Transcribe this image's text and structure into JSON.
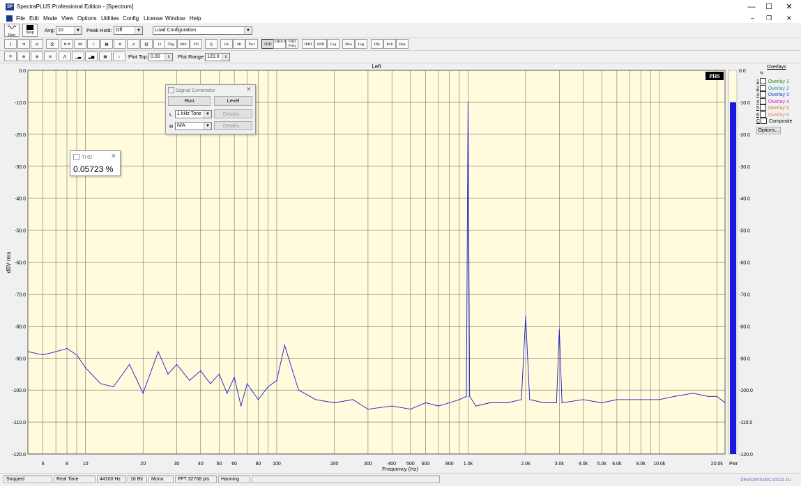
{
  "window": {
    "title": "SpectraPLUS Professional Edition - [Spectrum]",
    "app_icon": "SP",
    "min_glyph": "—",
    "max_glyph": "☐",
    "close_glyph": "✕"
  },
  "menu": [
    "File",
    "Edit",
    "Mode",
    "View",
    "Options",
    "Utilities",
    "Config",
    "License",
    "Window",
    "Help"
  ],
  "toolbar1": {
    "run_label": "Run",
    "stop_label": "Stop",
    "avg_label": "Avg:",
    "avg_value": "10",
    "peak_hold_label": "Peak Hold:",
    "peak_hold_value": "Off",
    "load_config_value": "Load Configuration"
  },
  "toolbar2": {
    "buttons": [
      "Trig",
      "Mrk",
      "I/O",
      "Hz",
      "dB",
      "Pwr",
      "THD",
      "THD+N",
      "THD Freq",
      "IMD",
      "SNR",
      "Leq",
      "Mus",
      "Log",
      "Dly",
      "Rvb",
      "Rep"
    ]
  },
  "toolbar3": {
    "plot_top_label": "Plot Top:",
    "plot_top_value": "0.00",
    "plot_range_label": "Plot Range:",
    "plot_range_value": "120.0"
  },
  "plot": {
    "title": "Left",
    "logo": "PHS",
    "pwr_label": "Pwr"
  },
  "signal_generator": {
    "title": "Signal Generator",
    "run_label": "Run",
    "level_label": "Level",
    "l_label": "L",
    "l_value": "1 kHz Tone",
    "l_details": "Details...",
    "r_label": "R",
    "r_value": "N/A",
    "r_details": "Details..."
  },
  "thd_window": {
    "title": "THD",
    "value": "0.05723 %"
  },
  "overlays": {
    "title": "Overlays",
    "header_glyph": "%",
    "items": [
      {
        "num": "1",
        "label": "Overlay 1",
        "color": "#2e8b2e"
      },
      {
        "num": "2",
        "label": "Overlay 2",
        "color": "#20a0a0"
      },
      {
        "num": "3",
        "label": "Overlay 3",
        "color": "#1a3bd0"
      },
      {
        "num": "4",
        "label": "Overlay 4",
        "color": "#d020d0"
      },
      {
        "num": "5",
        "label": "Overlay 5",
        "color": "#c08020"
      },
      {
        "num": "6",
        "label": "Overlay 6",
        "color": "#e08080"
      },
      {
        "num": "C",
        "label": "Composite",
        "color": "#000000"
      }
    ],
    "options_label": "Options..."
  },
  "status": {
    "state": "Stopped",
    "mode": "Real Time",
    "rate": "44100 Hz",
    "bits": "16 Bit",
    "channels": "Mono",
    "fft": "FFT 32768 pts",
    "window": "Hanning",
    "watermark": "devicemusic.ucoz.ru"
  },
  "chart_data": {
    "type": "line",
    "title": "Left",
    "xlabel": "Frequency (Hz)",
    "ylabel": "dBV rms",
    "xscale": "log",
    "xlim": [
      5,
      22050
    ],
    "ylim": [
      -120,
      0
    ],
    "x_ticks": [
      "6",
      "8",
      "10",
      "20",
      "30",
      "40",
      "50",
      "60",
      "80",
      "100",
      "200",
      "300",
      "400",
      "500",
      "600",
      "800",
      "1.0k",
      "2.0k",
      "3.0k",
      "4.0k",
      "5.0k",
      "6.0k",
      "8.0k",
      "10.0k",
      "20.0k"
    ],
    "y_ticks": [
      "0.0",
      "-10.0",
      "-20.0",
      "-30.0",
      "-40.0",
      "-50.0",
      "-60.0",
      "-70.0",
      "-80.0",
      "-90.0",
      "-100.0",
      "-110.0",
      "-120.0"
    ],
    "grid": true,
    "series": [
      {
        "color": "#1a1acc",
        "x": [
          5,
          6,
          7,
          8,
          9,
          10,
          12,
          14,
          17,
          20,
          24,
          27,
          30,
          35,
          40,
          45,
          50,
          55,
          60,
          65,
          70,
          80,
          90,
          100,
          110,
          130,
          160,
          200,
          250,
          300,
          400,
          500,
          600,
          700,
          800,
          900,
          980,
          1000,
          1020,
          1100,
          1300,
          1600,
          1900,
          2000,
          2100,
          2500,
          2900,
          3000,
          3100,
          4000,
          5000,
          6000,
          8000,
          10000,
          12000,
          15000,
          18000,
          20000,
          21000,
          22050
        ],
        "values": [
          -88,
          -89,
          -88,
          -87,
          -89,
          -93,
          -98,
          -99,
          -92,
          -101,
          -88,
          -95,
          -92,
          -97,
          -94,
          -98,
          -95,
          -101,
          -96,
          -105,
          -98,
          -103,
          -99,
          -97,
          -86,
          -100,
          -103,
          -104,
          -103,
          -106,
          -105,
          -106,
          -104,
          -105,
          -104,
          -103,
          -102,
          -10,
          -102,
          -105,
          -104,
          -104,
          -103,
          -77,
          -103,
          -104,
          -104,
          -81,
          -104,
          -103,
          -104,
          -103,
          -103,
          -103,
          -102,
          -101,
          -102,
          -102,
          -103,
          -104
        ]
      }
    ],
    "meter_value_db": -10
  }
}
